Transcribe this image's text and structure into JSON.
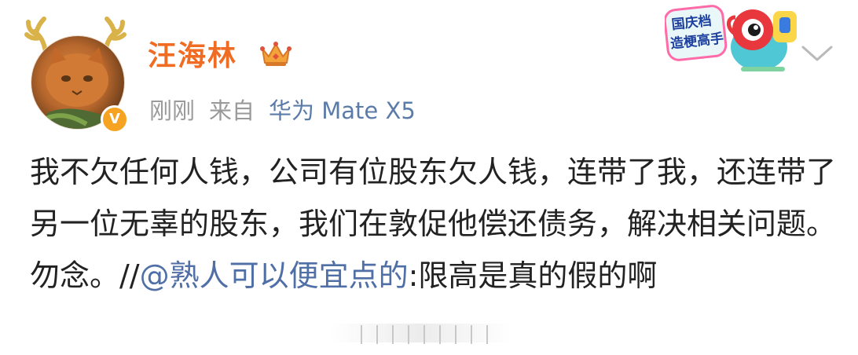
{
  "user": {
    "name": "汪海林",
    "verified_badge": "V",
    "crown_icon": "crown-icon"
  },
  "meta": {
    "time": "刚刚",
    "source_prefix": "来自",
    "device": "华为 Mate X5"
  },
  "sticker": {
    "line1": "国庆档",
    "line2": "造梗高手"
  },
  "post": {
    "text_before_mention": "我不欠任何人钱，公司有位股东欠人钱，连带了我，还连带了另一位无辜的股东，我们在敦促他偿还债务，解决相关问题。勿念。//",
    "mention": "@熟人可以便宜点的",
    "text_after_mention": ":限高是真的假的啊"
  },
  "colors": {
    "username": "#f06c22",
    "meta": "#9a9a9a",
    "link": "#4f6fa6",
    "text": "#222222",
    "badge": "#f6a321"
  }
}
